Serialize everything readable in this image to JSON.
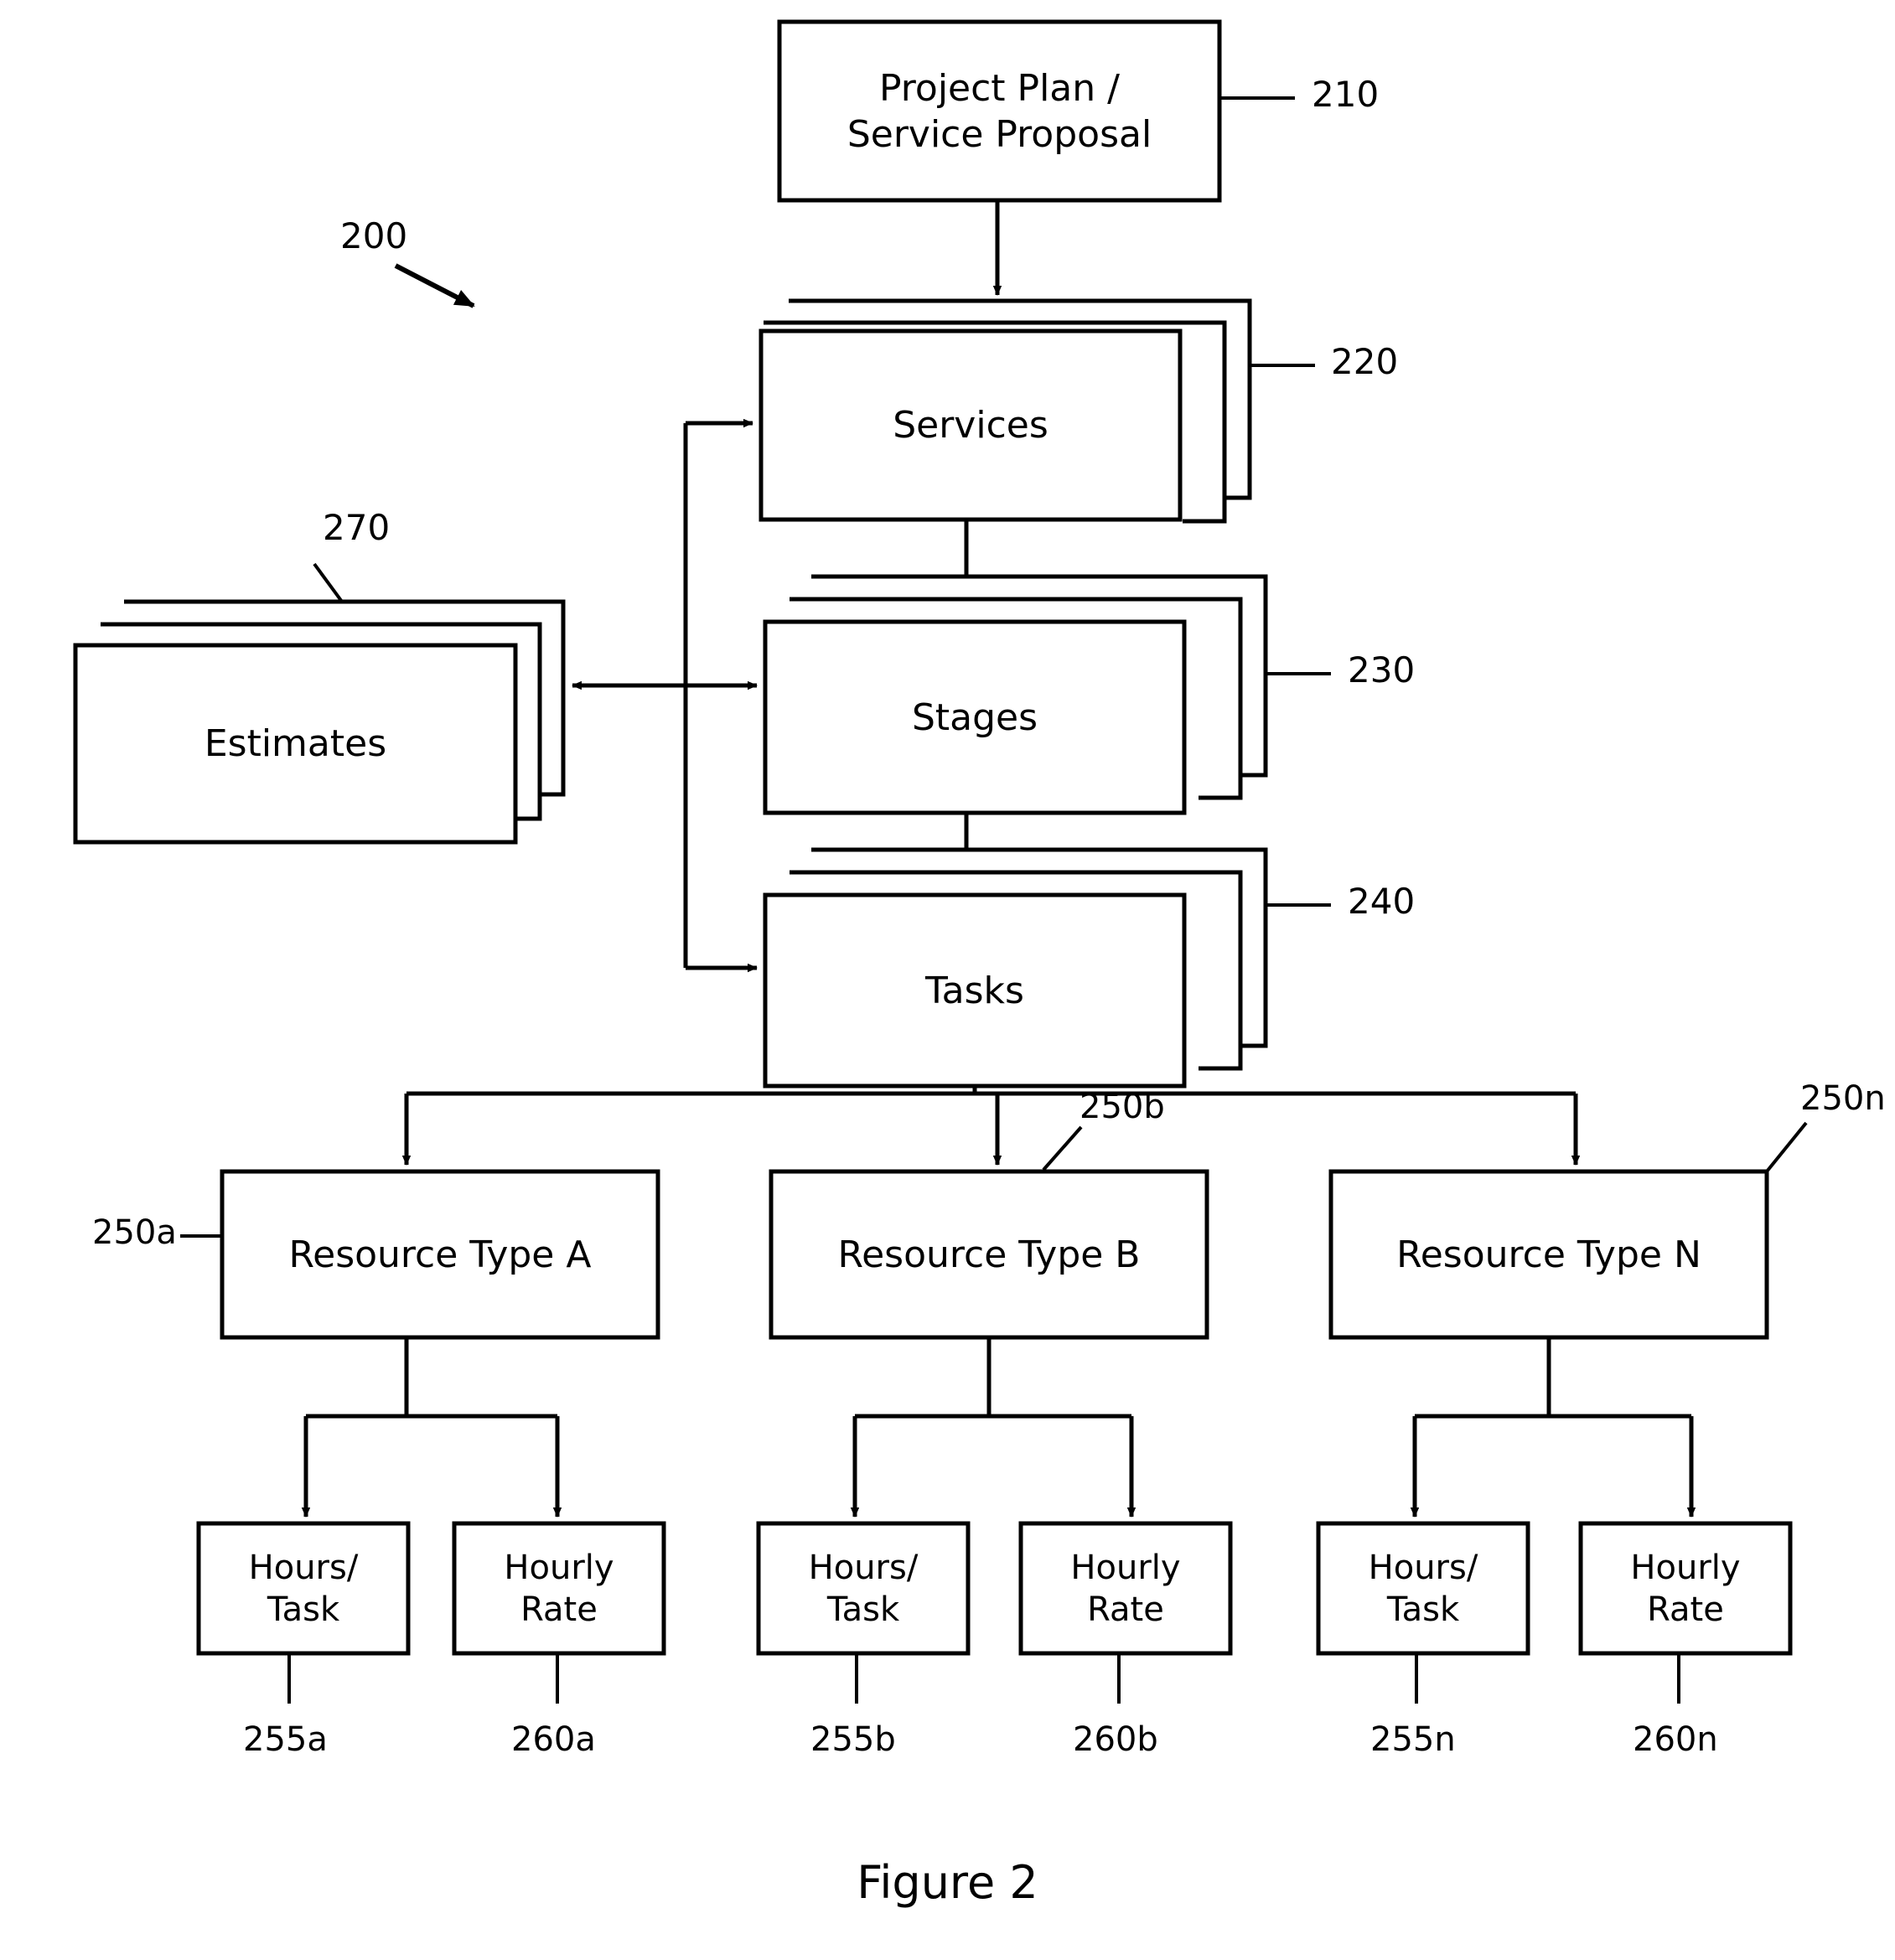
{
  "figure": {
    "caption": "Figure 2",
    "system_ref": "200"
  },
  "nodes": {
    "project_plan": {
      "label": "Project Plan /\nService Proposal",
      "ref": "210"
    },
    "services": {
      "label": "Services",
      "ref": "220"
    },
    "stages": {
      "label": "Stages",
      "ref": "230"
    },
    "tasks": {
      "label": "Tasks",
      "ref": "240"
    },
    "estimates": {
      "label": "Estimates",
      "ref": "270"
    }
  },
  "resources": [
    {
      "label": "Resource Type A",
      "ref": "250a",
      "children": [
        {
          "label": "Hours/\nTask",
          "ref": "255a"
        },
        {
          "label": "Hourly\nRate",
          "ref": "260a"
        }
      ]
    },
    {
      "label": "Resource Type B",
      "ref": "250b",
      "children": [
        {
          "label": "Hours/\nTask",
          "ref": "255b"
        },
        {
          "label": "Hourly\nRate",
          "ref": "260b"
        }
      ]
    },
    {
      "label": "Resource Type N",
      "ref": "250n",
      "children": [
        {
          "label": "Hours/\nTask",
          "ref": "255n"
        },
        {
          "label": "Hourly\nRate",
          "ref": "260n"
        }
      ]
    }
  ],
  "colors": {
    "line": "#000000",
    "background": "#ffffff",
    "text": "#000000"
  }
}
